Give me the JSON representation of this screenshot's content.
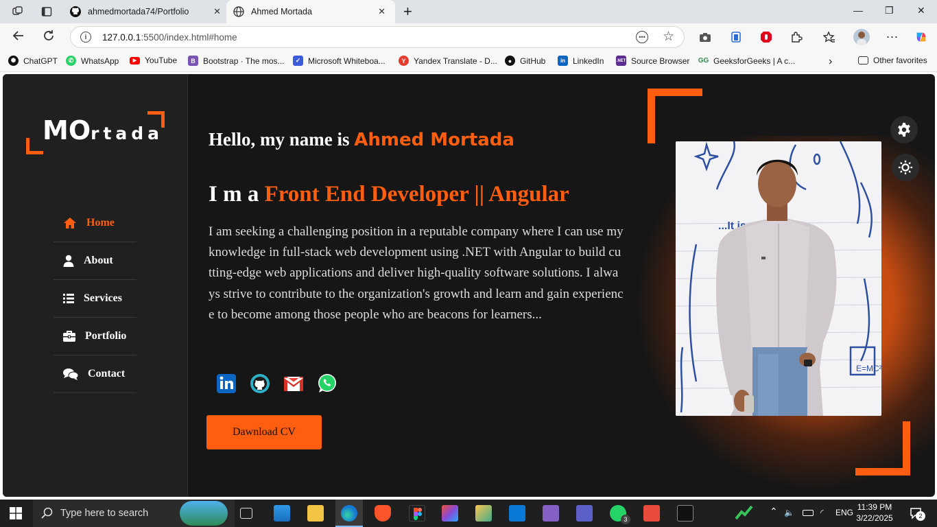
{
  "browser": {
    "tabs": [
      {
        "label": "ahmedmortada74/Portfolio",
        "icon": "github-icon"
      },
      {
        "label": "Ahmed Mortada",
        "icon": "globe-icon",
        "active": true
      }
    ],
    "url": {
      "host": "127.0.0.1",
      "rest": ":5500/index.html#home"
    },
    "bookmarks": [
      {
        "label": "ChatGPT",
        "color": "#111111"
      },
      {
        "label": "WhatsApp",
        "color": "#25d366"
      },
      {
        "label": "YouTube",
        "color": "#ff0000"
      },
      {
        "label": "Bootstrap · The mos...",
        "color": "#7952b3"
      },
      {
        "label": "Microsoft Whiteboa...",
        "color": "#3b5bdb"
      },
      {
        "label": "Yandex Translate - D...",
        "color": "#e63b2e"
      },
      {
        "label": "GitHub",
        "color": "#111111"
      },
      {
        "label": "LinkedIn",
        "color": "#0a66c2"
      },
      {
        "label": "Source Browser",
        "color": "#5c2d91"
      },
      {
        "label": "GeeksforGeeks | A c...",
        "color": "#2f8d46"
      }
    ],
    "other_favorites": "Other favorites"
  },
  "page": {
    "logo": {
      "big": "MO",
      "small": "rtada"
    },
    "nav": [
      {
        "label": "Home",
        "icon": "home-icon",
        "active": true
      },
      {
        "label": "About",
        "icon": "user-icon"
      },
      {
        "label": "Services",
        "icon": "list-icon"
      },
      {
        "label": "Portfolio",
        "icon": "briefcase-icon"
      },
      {
        "label": "Contact",
        "icon": "comments-icon"
      }
    ],
    "hello_prefix": "Hello, my name is",
    "name": "Ahmed Mortada",
    "role_prefix": "I m a",
    "role": "Front End Developer || Angular",
    "description": "I am seeking a challenging position in a reputable company where I can use my knowledge in full-stack web development using .NET with Angular to build cutting-edge web applications and deliver high-quality software solutions. I always strive to contribute to the organization's growth and learn and gain experience to become among those people who are beacons for learners...",
    "socials": [
      "linkedin-icon",
      "github-icon",
      "gmail-icon",
      "whatsapp-icon"
    ],
    "cv_button": "Dawnload CV",
    "accent": "#ff5e10"
  },
  "taskbar": {
    "search_placeholder": "Type here to search",
    "language": "ENG",
    "time": "11:39 PM",
    "date": "3/22/2025",
    "teams_badge": "3",
    "notification_count": "2"
  }
}
